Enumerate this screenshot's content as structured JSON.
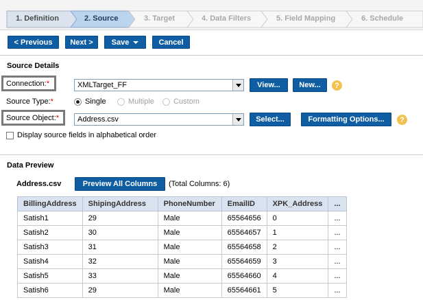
{
  "wizard": {
    "steps": [
      {
        "label": "1. Definition",
        "state": "done"
      },
      {
        "label": "2. Source",
        "state": "active"
      },
      {
        "label": "3. Target",
        "state": "future"
      },
      {
        "label": "4. Data Filters",
        "state": "future"
      },
      {
        "label": "5. Field Mapping",
        "state": "future"
      },
      {
        "label": "6. Schedule",
        "state": "future"
      }
    ]
  },
  "toolbar": {
    "previous_label": "< Previous",
    "next_label": "Next >",
    "save_label": "Save",
    "cancel_label": "Cancel"
  },
  "source_details": {
    "title": "Source Details",
    "connection_label": "Connection:",
    "connection_value": "XMLTarget_FF",
    "view_label": "View...",
    "new_label": "New...",
    "source_type_label": "Source Type:",
    "source_type_options": [
      "Single",
      "Multiple",
      "Custom"
    ],
    "source_type_selected": "Single",
    "source_object_label": "Source Object:",
    "source_object_value": "Address.csv",
    "select_label": "Select...",
    "formatting_label": "Formatting Options...",
    "alpha_order_label": "Display source fields in alphabetical order",
    "required_mark": "*",
    "help_glyph": "?"
  },
  "data_preview": {
    "title": "Data Preview",
    "file_name": "Address.csv",
    "preview_all_label": "Preview All Columns",
    "total_columns": "(Total Columns: 6)",
    "columns": [
      "BillingAddress",
      "ShipingAddress",
      "PhoneNumber",
      "EmailID",
      "XPK_Address",
      "..."
    ],
    "rows": [
      [
        "Satish1",
        "29",
        "Male",
        "65564656",
        "0",
        "..."
      ],
      [
        "Satish2",
        "30",
        "Male",
        "65564657",
        "1",
        "..."
      ],
      [
        "Satish3",
        "31",
        "Male",
        "65564658",
        "2",
        "..."
      ],
      [
        "Satish4",
        "32",
        "Male",
        "65564659",
        "3",
        "..."
      ],
      [
        "Satish5",
        "33",
        "Male",
        "65564660",
        "4",
        "..."
      ],
      [
        "Satish6",
        "29",
        "Male",
        "65564661",
        "5",
        "..."
      ]
    ]
  },
  "colors": {
    "button_blue": "#0f5da2",
    "active_step": "#bcd3ee",
    "required_red": "#d00000",
    "help_yellow": "#f2c14e"
  }
}
